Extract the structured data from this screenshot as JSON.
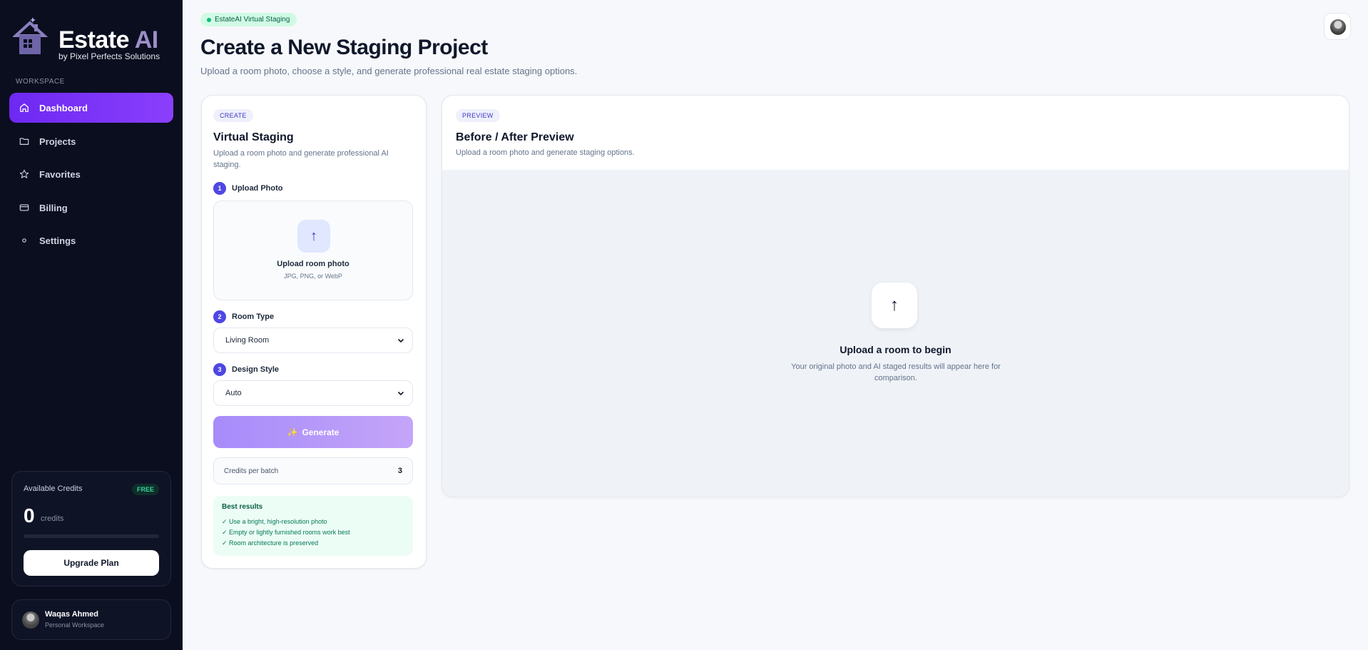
{
  "brand": {
    "name": "Estate",
    "name_accent": "AI",
    "tagline": "by Pixel Perfects Solutions"
  },
  "sidebar": {
    "section_label": "WORKSPACE",
    "items": [
      {
        "label": "Dashboard",
        "icon": "home-icon",
        "active": true
      },
      {
        "label": "Projects",
        "icon": "folder-icon",
        "active": false
      },
      {
        "label": "Favorites",
        "icon": "star-icon",
        "active": false
      },
      {
        "label": "Billing",
        "icon": "card-icon",
        "active": false
      },
      {
        "label": "Settings",
        "icon": "dot-icon",
        "active": false
      }
    ],
    "credits": {
      "label": "Available Credits",
      "badge": "FREE",
      "value": "0",
      "unit": "credits",
      "progress": 0,
      "upgrade_label": "Upgrade Plan"
    },
    "user": {
      "name": "Waqas Ahmed",
      "workspace": "Personal Workspace"
    }
  },
  "header": {
    "badge": "EstateAI Virtual Staging",
    "title": "Create a New Staging Project",
    "subtitle": "Upload a room photo, choose a style, and generate professional real estate staging options."
  },
  "create": {
    "pill": "CREATE",
    "title": "Virtual Staging",
    "description": "Upload a room photo and generate professional AI staging.",
    "steps": [
      {
        "num": "1",
        "label": "Upload Photo"
      },
      {
        "num": "2",
        "label": "Room Type"
      },
      {
        "num": "3",
        "label": "Design Style"
      }
    ],
    "upload": {
      "title": "Upload room photo",
      "formats": "JPG, PNG, or WebP",
      "icon": "↑"
    },
    "room_type": "Living Room",
    "design_style": "Auto",
    "generate_label": "Generate",
    "generate_icon": "✨",
    "credits_per_batch_label": "Credits per batch",
    "credits_per_batch_value": "3",
    "tips": {
      "title": "Best results",
      "items": [
        "✓ Use a bright, high-resolution photo",
        "✓ Empty or lightly furnished rooms work best",
        "✓ Room architecture is preserved"
      ]
    }
  },
  "preview": {
    "pill": "PREVIEW",
    "title": "Before / After Preview",
    "description": "Upload a room photo and generate staging options.",
    "empty_icon": "↑",
    "empty_title": "Upload a room to begin",
    "empty_sub": "Your original photo and AI staged results will appear here for comparison."
  },
  "colors": {
    "sidebar_bg": "#0b0e1f",
    "accent": "#7c3aed",
    "success": "#10b981"
  }
}
